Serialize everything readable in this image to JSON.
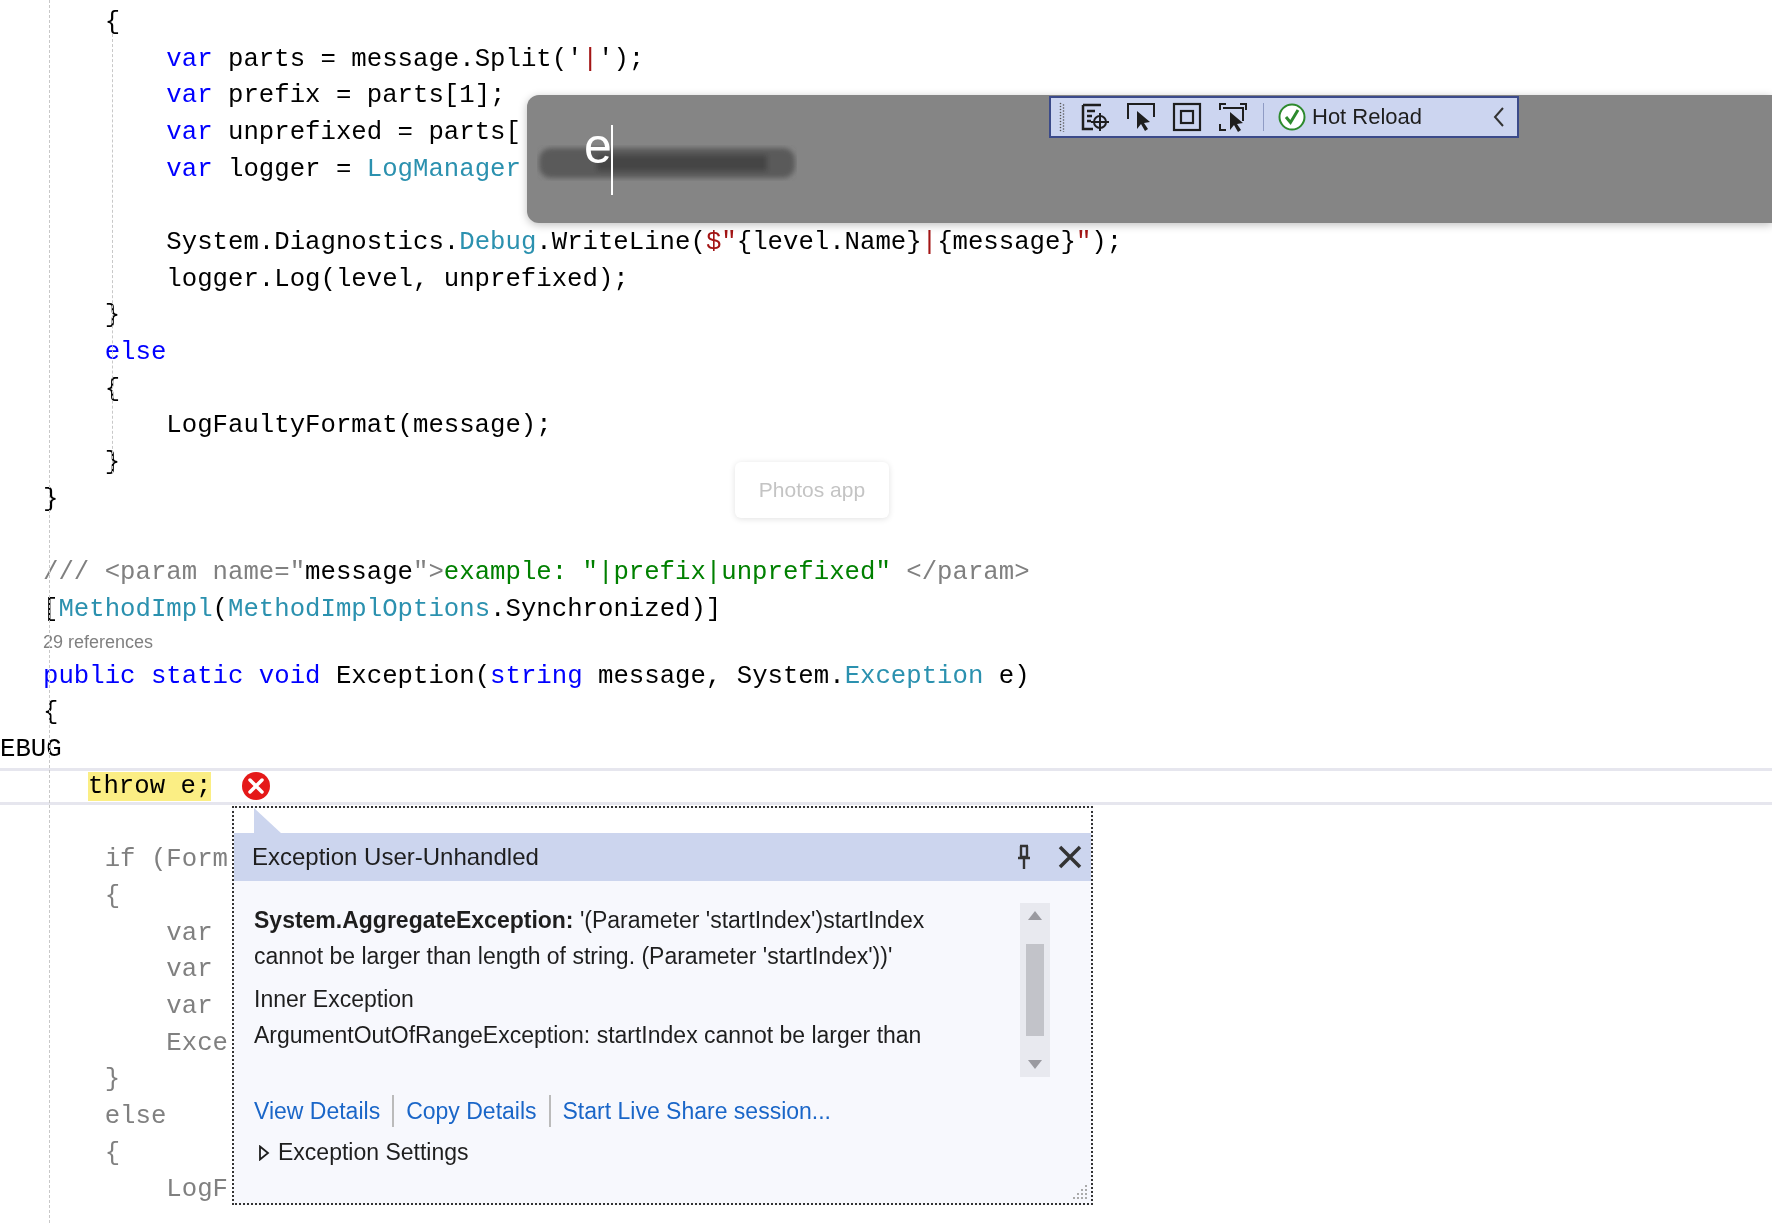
{
  "editor": {
    "lines": [
      {
        "kind": "code",
        "tokens": [
          {
            "text": "    {",
            "kind": "plain"
          }
        ]
      },
      {
        "kind": "code",
        "tokens": [
          {
            "text": "        var",
            "kind": "keyword"
          },
          {
            "text": " parts = message.Split('",
            "kind": "plain"
          },
          {
            "text": "|",
            "kind": "string"
          },
          {
            "text": "');",
            "kind": "plain"
          }
        ]
      },
      {
        "kind": "code",
        "tokens": [
          {
            "text": "        var",
            "kind": "keyword"
          },
          {
            "text": " prefix = parts[1];",
            "kind": "plain"
          }
        ]
      },
      {
        "kind": "code",
        "tokens": [
          {
            "text": "        var",
            "kind": "keyword"
          },
          {
            "text": " unprefixed = parts[",
            "kind": "plain"
          }
        ]
      },
      {
        "kind": "code",
        "tokens": [
          {
            "text": "        var",
            "kind": "keyword"
          },
          {
            "text": " logger = ",
            "kind": "plain"
          },
          {
            "text": "LogManager",
            "kind": "type"
          }
        ]
      },
      {
        "kind": "blank"
      },
      {
        "kind": "code",
        "tokens": [
          {
            "text": "        System.Diagnostics.",
            "kind": "plain"
          },
          {
            "text": "Debug",
            "kind": "type"
          },
          {
            "text": ".WriteLine(",
            "kind": "plain"
          },
          {
            "text": "$\"",
            "kind": "string"
          },
          {
            "text": "{level.Name}",
            "kind": "plain"
          },
          {
            "text": "|",
            "kind": "string"
          },
          {
            "text": "{message}",
            "kind": "plain"
          },
          {
            "text": "\"",
            "kind": "string"
          },
          {
            "text": ");",
            "kind": "plain"
          }
        ]
      },
      {
        "kind": "code",
        "tokens": [
          {
            "text": "        logger.Log(level, unprefixed);",
            "kind": "plain"
          }
        ]
      },
      {
        "kind": "code",
        "tokens": [
          {
            "text": "    }",
            "kind": "plain"
          }
        ]
      },
      {
        "kind": "code",
        "tokens": [
          {
            "text": "    else",
            "kind": "keyword"
          }
        ]
      },
      {
        "kind": "code",
        "tokens": [
          {
            "text": "    {",
            "kind": "plain"
          }
        ]
      },
      {
        "kind": "code",
        "tokens": [
          {
            "text": "        LogFaultyFormat(message);",
            "kind": "plain"
          }
        ]
      },
      {
        "kind": "code",
        "tokens": [
          {
            "text": "    }",
            "kind": "plain"
          }
        ]
      },
      {
        "kind": "code",
        "tokens": [
          {
            "text": "}",
            "kind": "plain"
          }
        ]
      },
      {
        "kind": "blank"
      },
      {
        "kind": "code",
        "tokens": [
          {
            "text": "/// <param name=\"",
            "kind": "comment"
          },
          {
            "text": "message",
            "kind": "plain"
          },
          {
            "text": "\">",
            "kind": "comment"
          },
          {
            "text": "example: \"|prefix|unprefixed\" ",
            "kind": "doc"
          },
          {
            "text": "</param>",
            "kind": "comment"
          }
        ]
      },
      {
        "kind": "code",
        "tokens": [
          {
            "text": "[",
            "kind": "plain"
          },
          {
            "text": "MethodImpl",
            "kind": "type"
          },
          {
            "text": "(",
            "kind": "plain"
          },
          {
            "text": "MethodImplOptions",
            "kind": "type"
          },
          {
            "text": ".Synchronized)]",
            "kind": "plain"
          }
        ]
      },
      {
        "kind": "codelens",
        "tokens": [
          {
            "text": "29 references",
            "kind": "comment"
          }
        ]
      },
      {
        "kind": "code",
        "tokens": [
          {
            "text": "public static void",
            "kind": "keyword"
          },
          {
            "text": " Exception(",
            "kind": "plain"
          },
          {
            "text": "string",
            "kind": "keyword"
          },
          {
            "text": " message, System.",
            "kind": "plain"
          },
          {
            "text": "Exception",
            "kind": "type"
          },
          {
            "text": " e)",
            "kind": "plain"
          }
        ]
      },
      {
        "kind": "code",
        "tokens": [
          {
            "text": "{",
            "kind": "plain"
          }
        ]
      },
      {
        "kind": "directive",
        "tokens": [
          {
            "text": "EBUG",
            "kind": "plain"
          }
        ]
      },
      {
        "kind": "current",
        "tokens": [
          {
            "text": "throw e;",
            "kind": "highlight"
          }
        ]
      },
      {
        "kind": "blank"
      },
      {
        "kind": "code",
        "tokens": [
          {
            "text": "    if (Form",
            "kind": "inactive"
          }
        ]
      },
      {
        "kind": "code",
        "tokens": [
          {
            "text": "    {",
            "kind": "inactive"
          }
        ]
      },
      {
        "kind": "code",
        "tokens": [
          {
            "text": "        var",
            "kind": "inactive"
          }
        ]
      },
      {
        "kind": "code",
        "tokens": [
          {
            "text": "        var",
            "kind": "inactive"
          }
        ]
      },
      {
        "kind": "code",
        "tokens": [
          {
            "text": "        var",
            "kind": "inactive"
          }
        ]
      },
      {
        "kind": "code",
        "tokens": [
          {
            "text": "        Exce",
            "kind": "inactive"
          }
        ]
      },
      {
        "kind": "code",
        "tokens": [
          {
            "text": "    }",
            "kind": "inactive"
          }
        ]
      },
      {
        "kind": "code",
        "tokens": [
          {
            "text": "    else",
            "kind": "inactive"
          }
        ]
      },
      {
        "kind": "code",
        "tokens": [
          {
            "text": "    {",
            "kind": "inactive"
          }
        ]
      },
      {
        "kind": "code",
        "tokens": [
          {
            "text": "        LogF",
            "kind": "inactive"
          }
        ]
      }
    ]
  },
  "overlay": {
    "typed_text": "e"
  },
  "hot_reload_toolbar": {
    "label": "Hot Reload"
  },
  "tooltip": {
    "text": "Photos app"
  },
  "exception_popup": {
    "title": "Exception User-Unhandled",
    "message": "**System.AggregateException:** '(Parameter 'startIndex')startIndex cannot be larger than length of string. (Parameter 'startIndex'))'",
    "inner_heading": "Inner Exception",
    "inner_message": "ArgumentOutOfRangeException: startIndex cannot be larger than",
    "links": [
      "View Details",
      "Copy Details",
      "Start Live Share session..."
    ],
    "settings": {
      "label": "Exception Settings",
      "expanded": false
    }
  }
}
